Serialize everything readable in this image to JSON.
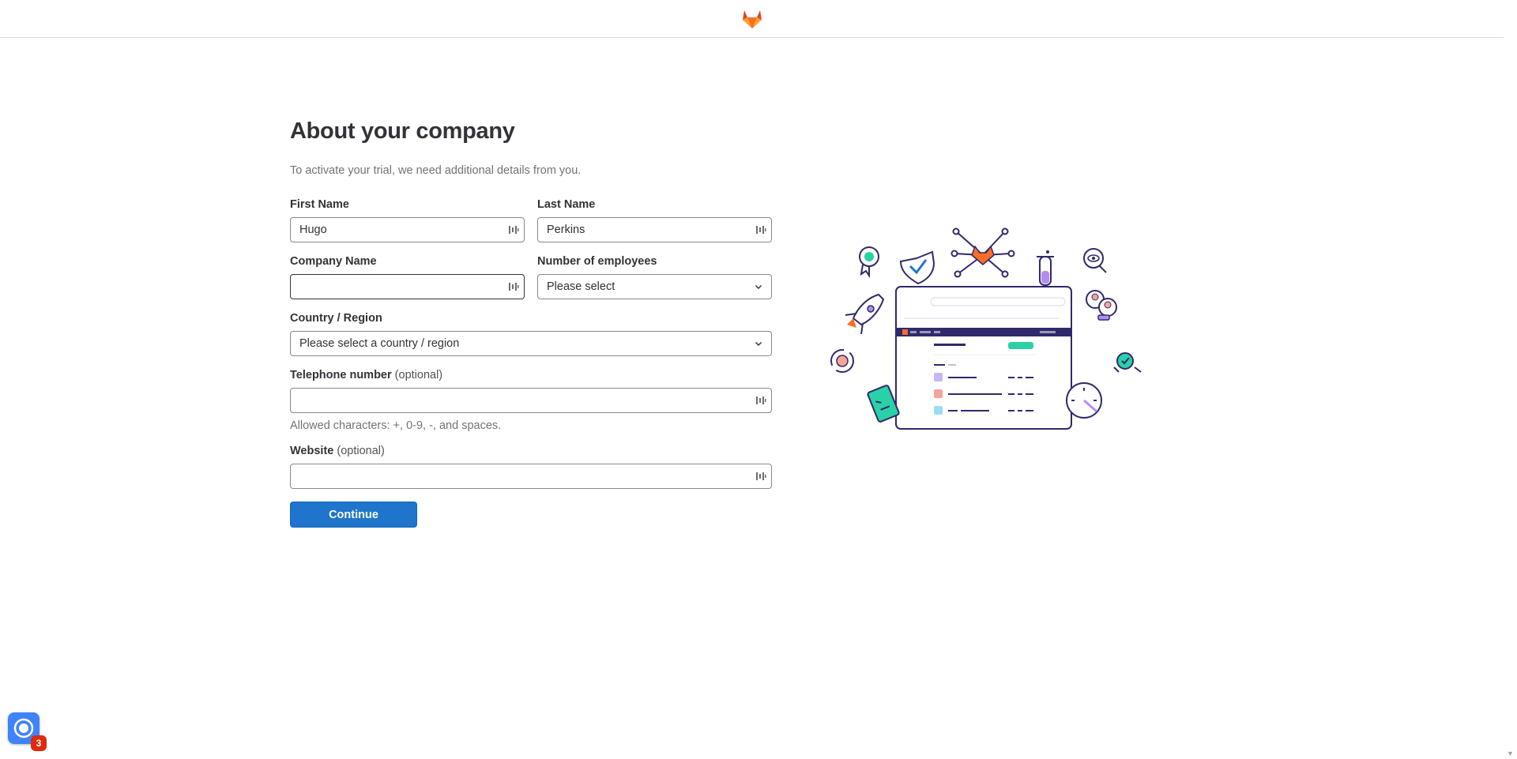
{
  "header": {
    "logo_icon": "gitlab-tanuki-icon"
  },
  "form": {
    "title": "About your company",
    "subtitle": "To activate your trial, we need additional details from you.",
    "first_name": {
      "label": "First Name",
      "value": "Hugo"
    },
    "last_name": {
      "label": "Last Name",
      "value": "Perkins"
    },
    "company_name": {
      "label": "Company Name",
      "value": ""
    },
    "employees": {
      "label": "Number of employees",
      "selected": "Please select"
    },
    "country": {
      "label": "Country / Region",
      "selected": "Please select a country / region"
    },
    "telephone": {
      "label": "Telephone number",
      "optional": "(optional)",
      "value": "",
      "hint": "Allowed characters: +, 0-9, -, and spaces."
    },
    "website": {
      "label": "Website",
      "optional": "(optional)",
      "value": ""
    },
    "continue_label": "Continue"
  },
  "chat_widget": {
    "badge_count": "3"
  },
  "colors": {
    "primary": "#1f75cb",
    "gitlab_orange": "#fc6d26",
    "illus_purple": "#2f2a6b",
    "badge_red": "#dd2b0e"
  }
}
